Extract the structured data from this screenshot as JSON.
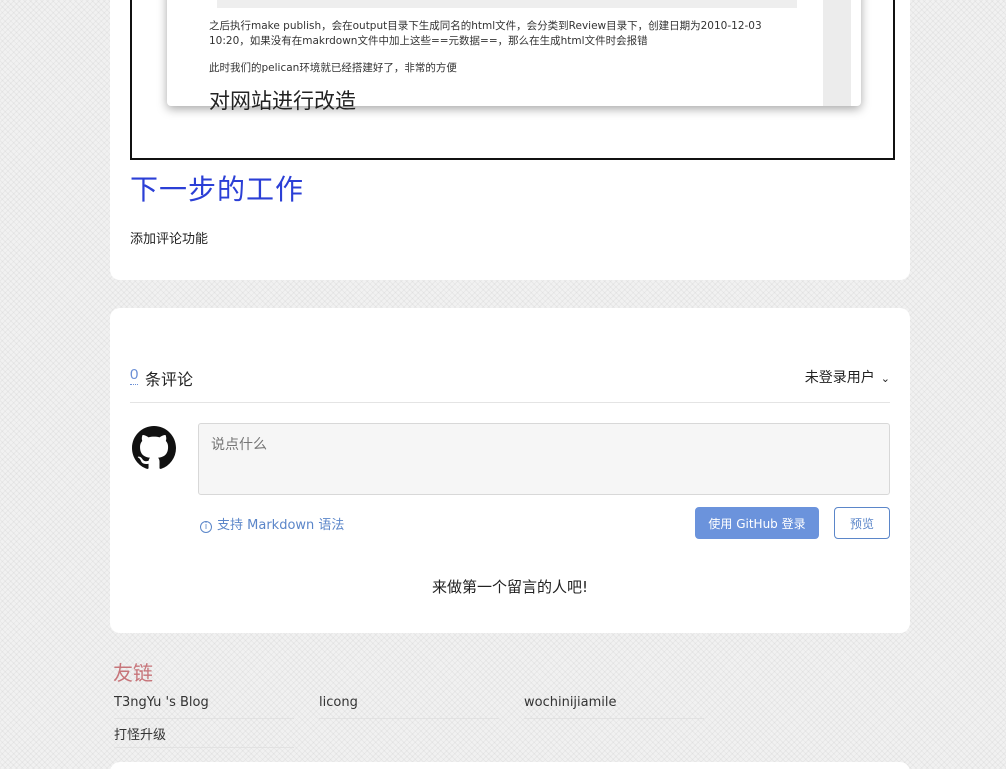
{
  "article": {
    "screenshot": {
      "paragraph1": "之后执行make publish，会在output目录下生成同名的html文件，会分类到Review目录下，创建日期为2010-12-03 10:20，如果没有在makrdown文件中加上这些==元数据==，那么在生成html文件时会报错",
      "paragraph2": "此时我们的pelican环境就已经搭建好了，非常的方便",
      "heading": "对网站进行改造"
    },
    "next_steps_heading": "下一步的工作",
    "next_steps_text": "添加评论功能"
  },
  "comments": {
    "count": "0",
    "count_label": "条评论",
    "user_menu": "未登录用户",
    "textarea_placeholder": "说点什么",
    "markdown_hint": "支持 Markdown 语法",
    "login_button": "使用 GitHub 登录",
    "preview_button": "预览",
    "empty_message": "来做第一个留言的人吧!",
    "avatar_icon": "github-icon"
  },
  "friend_links": {
    "title": "友链",
    "items": [
      "T3ngYu 's Blog",
      "licong",
      "wochinijiamile",
      "打怪升级"
    ]
  },
  "colors": {
    "link_blue": "#2b3fd6",
    "accent": "#6b93dc",
    "friend_title": "#c7757a"
  }
}
